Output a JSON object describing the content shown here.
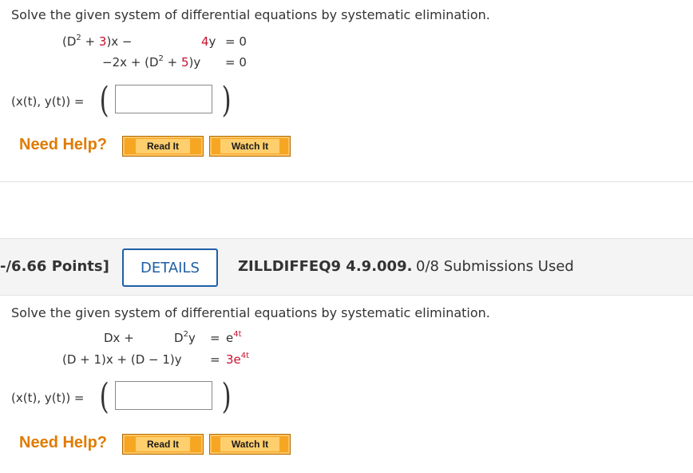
{
  "q1": {
    "prompt": "Solve the given system of differential equations by systematic elimination.",
    "eq1_left": "(D",
    "eq1_exp": "2",
    "eq1_plus": " + ",
    "eq1_coef": "3",
    "eq1_rest": ")x −",
    "eq1_right_coef": "4",
    "eq1_right_var": "y",
    "eq1_eq": "= 0",
    "eq2_left": "−2x + (D",
    "eq2_exp": "2",
    "eq2_plus": " + ",
    "eq2_coef": "5",
    "eq2_rest": ")y",
    "eq2_eq": "= 0",
    "answer_label": "(x(t), y(t)) =",
    "answer_value": "",
    "help_label": "Need Help?",
    "read_label": "Read It",
    "watch_label": "Watch It"
  },
  "q2": {
    "points": "-/6.66 Points]",
    "details_label": "DETAILS",
    "code": "ZILLDIFFEQ9 4.9.009.",
    "submissions": "0/8 Submissions Used",
    "prompt": "Solve the given system of differential equations by systematic elimination.",
    "eq1_left": "Dx +",
    "eq1_mid": "D",
    "eq1_mid_exp": "2",
    "eq1_mid_var": "y",
    "eq1_eq": "=",
    "eq1_rhs_base": "e",
    "eq1_rhs_exp": "4t",
    "eq2_left": "(D + 1)x + (D − 1)y",
    "eq2_eq": "=",
    "eq2_rhs_coef": "3e",
    "eq2_rhs_exp": "4t",
    "answer_label": "(x(t), y(t)) =",
    "answer_value": "",
    "help_label": "Need Help?",
    "read_label": "Read It",
    "watch_label": "Watch It"
  },
  "colors": {
    "accent_red": "#c8102e",
    "help_orange": "#e07b00",
    "button_orange": "#f6a623",
    "details_blue": "#1f5fa6"
  }
}
